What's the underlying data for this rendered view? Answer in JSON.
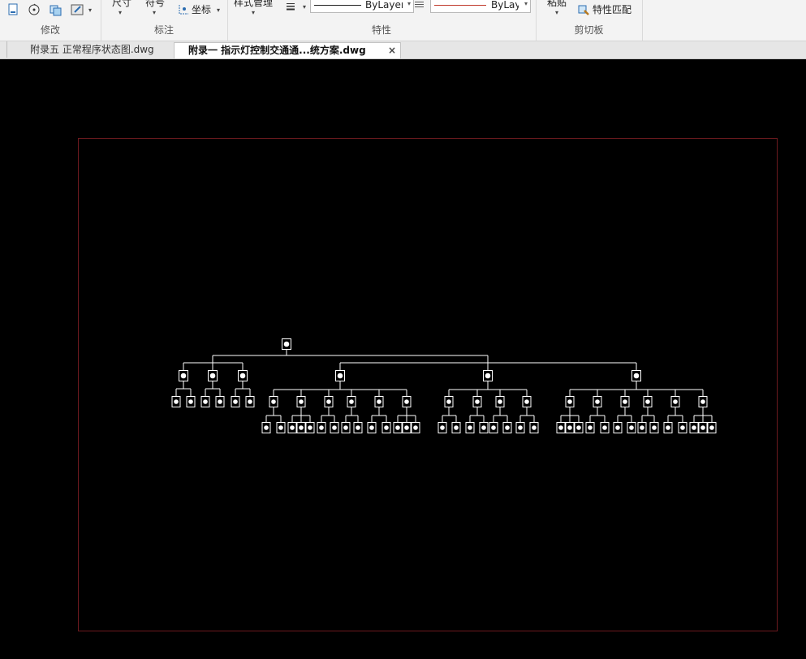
{
  "ribbon": {
    "panels": [
      {
        "title": "修改"
      },
      {
        "title": "标注"
      },
      {
        "title": "特性"
      },
      {
        "title": "剪切板"
      }
    ],
    "dimension_label": "尺寸",
    "symbol_label": "符号",
    "coordinate_label": "坐标",
    "style_manager_label": "样式管理",
    "linetype_combo": "ByLayer",
    "color_combo": "ByLayer",
    "paste_label": "粘贴",
    "match_properties_label": "特性匹配",
    "accent_color": "#c0392b"
  },
  "tabs": [
    {
      "label": "附录五 正常程序状态图.dwg",
      "active": false
    },
    {
      "label": "附录一 指示灯控制交通通...统方案.dwg",
      "active": true,
      "close": "×"
    }
  ],
  "canvas": {
    "background": "#000000",
    "frame_color": "#6d1a1f",
    "diagram_color": "#ffffff"
  }
}
